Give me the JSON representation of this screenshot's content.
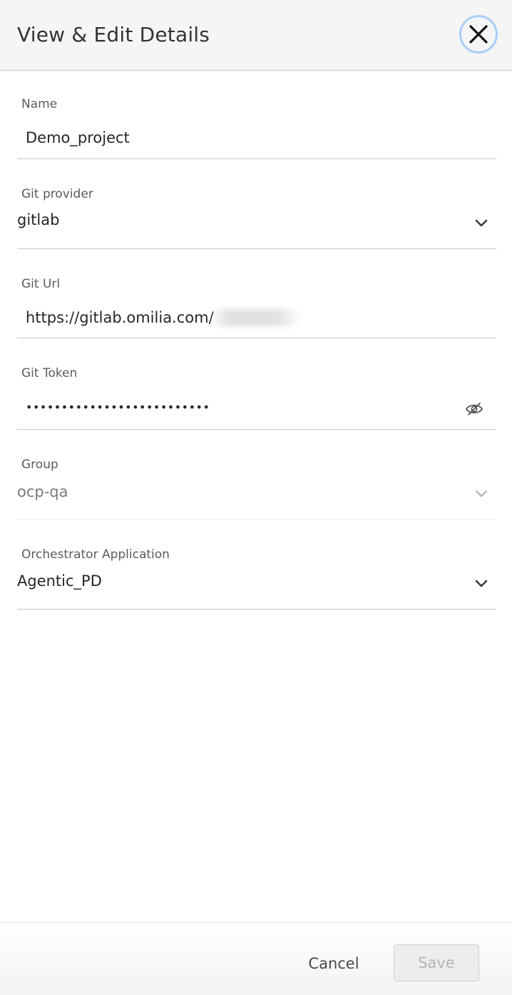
{
  "header": {
    "title": "View & Edit Details",
    "close_icon": "close-icon"
  },
  "form": {
    "name": {
      "label": "Name",
      "value": "Demo_project"
    },
    "git_provider": {
      "label": "Git provider",
      "value": "gitlab",
      "icon": "chevron-down-icon"
    },
    "git_url": {
      "label": "Git Url",
      "value": "https://gitlab.omilia.com/"
    },
    "git_token": {
      "label": "Git Token",
      "value": "••••••••••••••••••••••••••",
      "icon": "eye-off-icon"
    },
    "group": {
      "label": "Group",
      "value": "ocp-qa",
      "icon": "chevron-down-icon"
    },
    "orchestrator": {
      "label": "Orchestrator Application",
      "value": "Agentic_PD",
      "icon": "chevron-down-icon"
    }
  },
  "footer": {
    "cancel_label": "Cancel",
    "save_label": "Save"
  },
  "colors": {
    "header_bg": "#f5f5f5",
    "focus_ring": "#a9cdf6",
    "divider": "#c9c9c9",
    "disabled_text": "#b5b5b5"
  }
}
